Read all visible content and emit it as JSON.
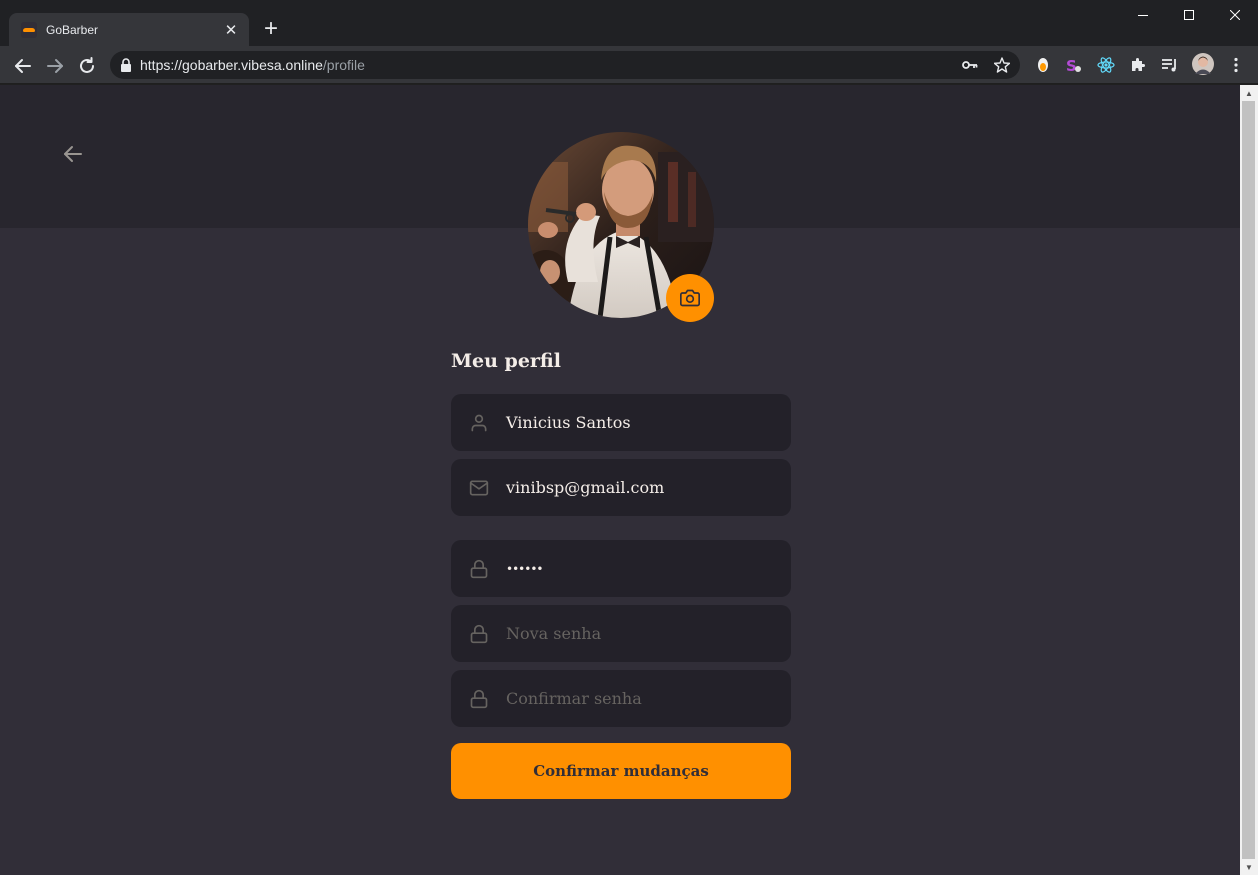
{
  "browser": {
    "tab_title": "GoBarber",
    "url_host": "https://gobarber.vibesa.online",
    "url_path": "/profile"
  },
  "page": {
    "title": "Meu perfil",
    "fields": {
      "name": "Vinicius Santos",
      "email": "vinibsp@gmail.com",
      "old_password": "••••••",
      "new_password_placeholder": "Nova senha",
      "confirm_password_placeholder": "Confirmar senha"
    },
    "submit_label": "Confirmar mudanças"
  },
  "colors": {
    "accent": "#ff9000",
    "background": "#312e38",
    "header": "#28262e",
    "input": "#232129"
  },
  "icons": {
    "back": "arrow-left-icon",
    "camera": "camera-icon",
    "user": "user-icon",
    "mail": "mail-icon",
    "lock": "lock-icon"
  }
}
